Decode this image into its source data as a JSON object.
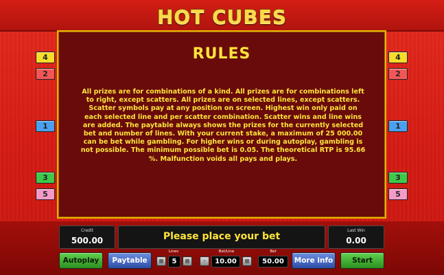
{
  "game": {
    "title": "HOT CUBES"
  },
  "rules": {
    "heading": "RULES",
    "body": "All prizes are for combinations of a kind. All prizes are for combinations left to right, except scatters. All prizes are on selected lines, except scatters. Scatter symbols pay at any position on screen. Highest win only paid on each selected line and per scatter combination. Scatter wins and line wins are added. The paytable always shows the prizes for the currently selected bet and number of lines. With your current stake, a maximum of 25 000.00 can be bet while gambling. For higher wins or during autoplay, gambling is not possible. The minimum possible bet is 0.05. The theoretical RTP is 95.66 %. Malfunction voids all pays and plays."
  },
  "line_markers": {
    "left": [
      {
        "label": "4",
        "color": "#f6dd2a"
      },
      {
        "label": "2",
        "color": "#f25656"
      },
      {
        "label": "1",
        "color": "#4aa0f0"
      },
      {
        "label": "3",
        "color": "#3fc94a"
      },
      {
        "label": "5",
        "color": "#f59ac8"
      }
    ],
    "right": [
      {
        "label": "4",
        "color": "#f6dd2a"
      },
      {
        "label": "2",
        "color": "#f25656"
      },
      {
        "label": "1",
        "color": "#4aa0f0"
      },
      {
        "label": "3",
        "color": "#3fc94a"
      },
      {
        "label": "5",
        "color": "#f59ac8"
      }
    ]
  },
  "status": {
    "credit_label": "Credit",
    "credit_value": "500.00",
    "message": "Please place your bet",
    "last_win_label": "Last Win",
    "last_win_value": "0.00"
  },
  "controls": {
    "autoplay": "Autoplay",
    "paytable": "Paytable",
    "lines_label": "Lines",
    "lines_value": "5",
    "bet_line_label": "Bet/Line",
    "bet_line_value": "10.00",
    "bet_label": "Bet",
    "bet_value": "50.00",
    "more_info": "More info",
    "start": "Start",
    "minus_symbol": "-"
  }
}
